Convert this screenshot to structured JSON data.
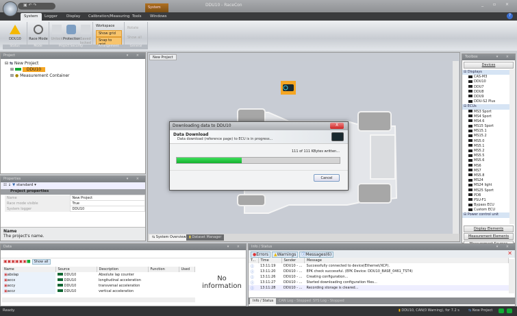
{
  "window": {
    "title": "DDU10 - RaceCon",
    "controls": "_ ▫ ×"
  },
  "contextual_tab": "System",
  "menu": {
    "tabs": [
      "System",
      "Logger",
      "Display",
      "Calibration/Measuring",
      "Tools",
      "Windows"
    ],
    "active": "System"
  },
  "ribbon": {
    "groups": [
      {
        "label": "Status",
        "buttons": [
          "DDU10"
        ]
      },
      {
        "label": "Mode",
        "buttons": [
          "Race Mode"
        ]
      },
      {
        "label": "Project Security",
        "buttons": [
          "Unlock",
          "Protection",
          "Saved locked"
        ]
      },
      {
        "label": "Arrangement",
        "title": "Workspace",
        "buttons": [
          "Show grid",
          "Snap to grid"
        ]
      },
      {
        "label": "General",
        "buttons": [
          "Rotate",
          "Show all"
        ]
      }
    ]
  },
  "project": {
    "title": "Project",
    "tree": [
      {
        "label": "New Project"
      },
      {
        "label": "DDU10",
        "selected": true
      },
      {
        "label": "Measurement Container"
      }
    ]
  },
  "properties": {
    "title": "Properties",
    "filter": "standard",
    "category": "Project properties",
    "rows": [
      {
        "name": "Name",
        "value": "New Project"
      },
      {
        "name": "Race mode visible",
        "value": "True"
      },
      {
        "name": "System logger",
        "value": "DDU10"
      }
    ],
    "help_title": "Name",
    "help_text": "The project's name."
  },
  "document": {
    "tab": "New Project",
    "bottom_tabs": [
      "System Overview",
      "Dataset Manager"
    ]
  },
  "dialog": {
    "title": "Downloading data to DDU10",
    "close": "X",
    "heading": "Data Download",
    "message": "Data download (reference page) to ECU is in progress...",
    "progress_text": "111 of 111 KBytes written...",
    "progress_percent": 40,
    "cancel": "Cancel",
    "progress_color": "#1ec43a"
  },
  "toolbox": {
    "title": "Toolbox",
    "top_button": "Devices",
    "categories": [
      {
        "label": "Displays",
        "items": [
          "CAS-M3",
          "DDU10",
          "DDU7",
          "DDU8",
          "DDU9",
          "DDU-S2 Plus"
        ]
      },
      {
        "label": "ECUs",
        "items": [
          "MS3 Sport",
          "MS4 Sport",
          "MS4.6",
          "MS15 Sport",
          "MS15.1",
          "MS15.2",
          "MS5.0",
          "MS5.1",
          "MS5.2",
          "MS5.5",
          "MS5.6",
          "MS6",
          "MS7",
          "MS5.8",
          "MS24",
          "MS24 light",
          "MS25 Sport",
          "PDB",
          "PSU-F1",
          "Bypass ECU",
          "Custom ECU"
        ]
      },
      {
        "label": "Power control unit",
        "items": []
      }
    ],
    "bottom_buttons": [
      "Display Elements",
      "Measurement Elements",
      "Measurement Sources"
    ]
  },
  "data_panel": {
    "title": "Data",
    "show_all": "Show all",
    "columns": [
      "Name",
      "Source",
      "Description",
      "Function",
      "Used"
    ],
    "rows": [
      {
        "name": "abslap",
        "source": "DDU10",
        "description": "Absolute lap counter"
      },
      {
        "name": "accx",
        "source": "DDU10",
        "description": "longitudinal acceleration"
      },
      {
        "name": "accy",
        "source": "DDU10",
        "description": "transversal acceleration"
      },
      {
        "name": "accz",
        "source": "DDU10",
        "description": "vertical acceleration"
      }
    ],
    "no_info": "No information"
  },
  "info_panel": {
    "title": "Info / Status",
    "filters": [
      "Errors",
      "Warnings",
      "Messages(6)"
    ],
    "columns": [
      "T...",
      "Time",
      "Sender",
      "Message"
    ],
    "rows": [
      {
        "time": "13:11:19",
        "sender": "DDU10 - ...",
        "message": "Successfully connected to device(Ethernet/XCP)."
      },
      {
        "time": "13:11:20",
        "sender": "DDU10 - ...",
        "message": "EPK check successful. (EPK Device: DDU10_BASE_0461_TST4)"
      },
      {
        "time": "13:11:26",
        "sender": "DDU10 - ...",
        "message": "Creating configuration..."
      },
      {
        "time": "13:11:27",
        "sender": "DDU10 - ...",
        "message": "Started downloading configuration files..."
      },
      {
        "time": "13:11:28",
        "sender": "DDU10 - ...",
        "message": "Recording storage is cleared..."
      }
    ],
    "tabs": [
      "Info / Status",
      "CAN Log - Stopped",
      "SYS Log - Stopped"
    ]
  },
  "statusbar": {
    "left": "Ready.",
    "device": "DDU10, CAN(0 Warning), for 7.2 s",
    "project": "New Project"
  }
}
